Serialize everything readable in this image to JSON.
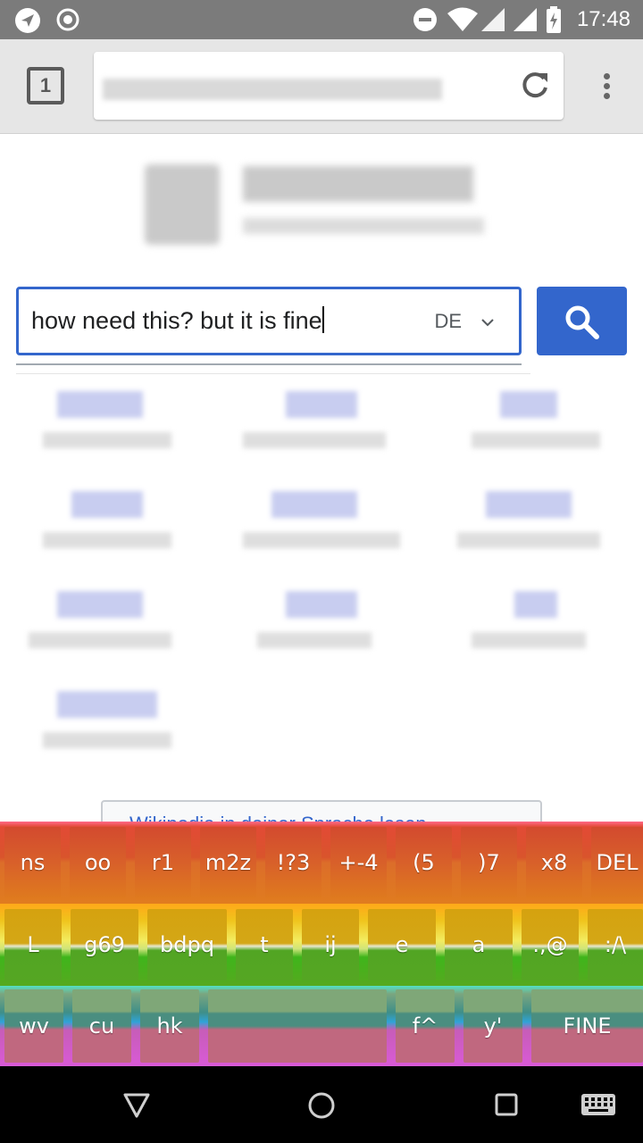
{
  "status_bar": {
    "time": "17:48",
    "icons": [
      "navigation-icon",
      "sync-icon",
      "do-not-disturb-icon",
      "wifi-icon",
      "signal-icon",
      "cell-signal-icon",
      "battery-charging-icon"
    ]
  },
  "browser": {
    "tab_count": "1"
  },
  "search": {
    "query": "how need this? but it is fine",
    "language": "DE"
  },
  "read_in_language": "Wikipedia in deiner Sprache lesen",
  "keyboard": {
    "row1": [
      "ns",
      "oo",
      "r1",
      "m2z",
      "!?3",
      "+-4",
      "(5",
      ")7",
      "x8",
      "DEL"
    ],
    "row2": [
      "L",
      "g69",
      "bdpq",
      "t",
      "ij",
      "e",
      "a",
      ".,@",
      ":/\\"
    ],
    "row3": [
      "wv",
      "cu",
      "hk",
      "",
      "f^",
      "y'",
      "FINE"
    ]
  },
  "colors": {
    "accent": "#3366cc",
    "status_bar": "#7b7b7b",
    "toolbar": "#e6e6e6"
  }
}
